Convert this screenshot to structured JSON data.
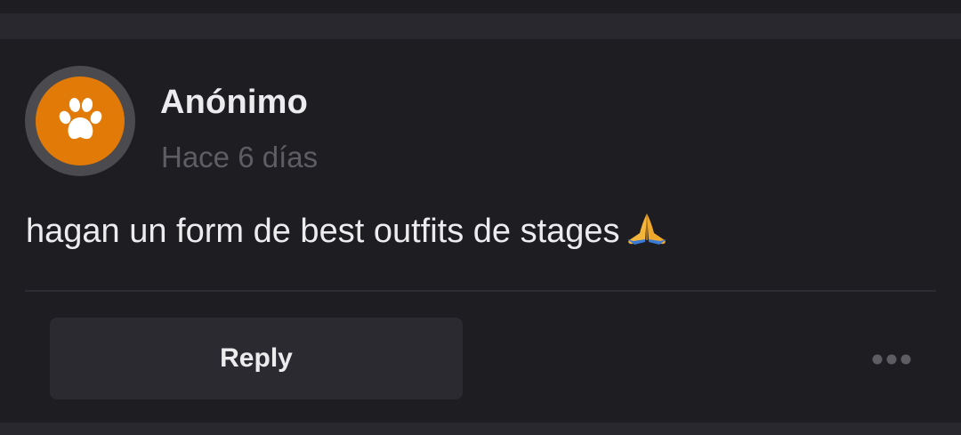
{
  "comment": {
    "author": "Anónimo",
    "timestamp": "Hace 6 días",
    "text": "hagan un form de best outfits de stages",
    "emoji_icon": "folded-hands-icon",
    "avatar_icon": "paw-icon"
  },
  "actions": {
    "reply_label": "Reply",
    "more_icon": "more-dots-icon"
  },
  "colors": {
    "background": "#1d1d22",
    "avatar_orange": "#e17a07",
    "button_bg": "#2a2a30",
    "text_primary": "#ececee",
    "text_secondary": "#5d5d63"
  }
}
